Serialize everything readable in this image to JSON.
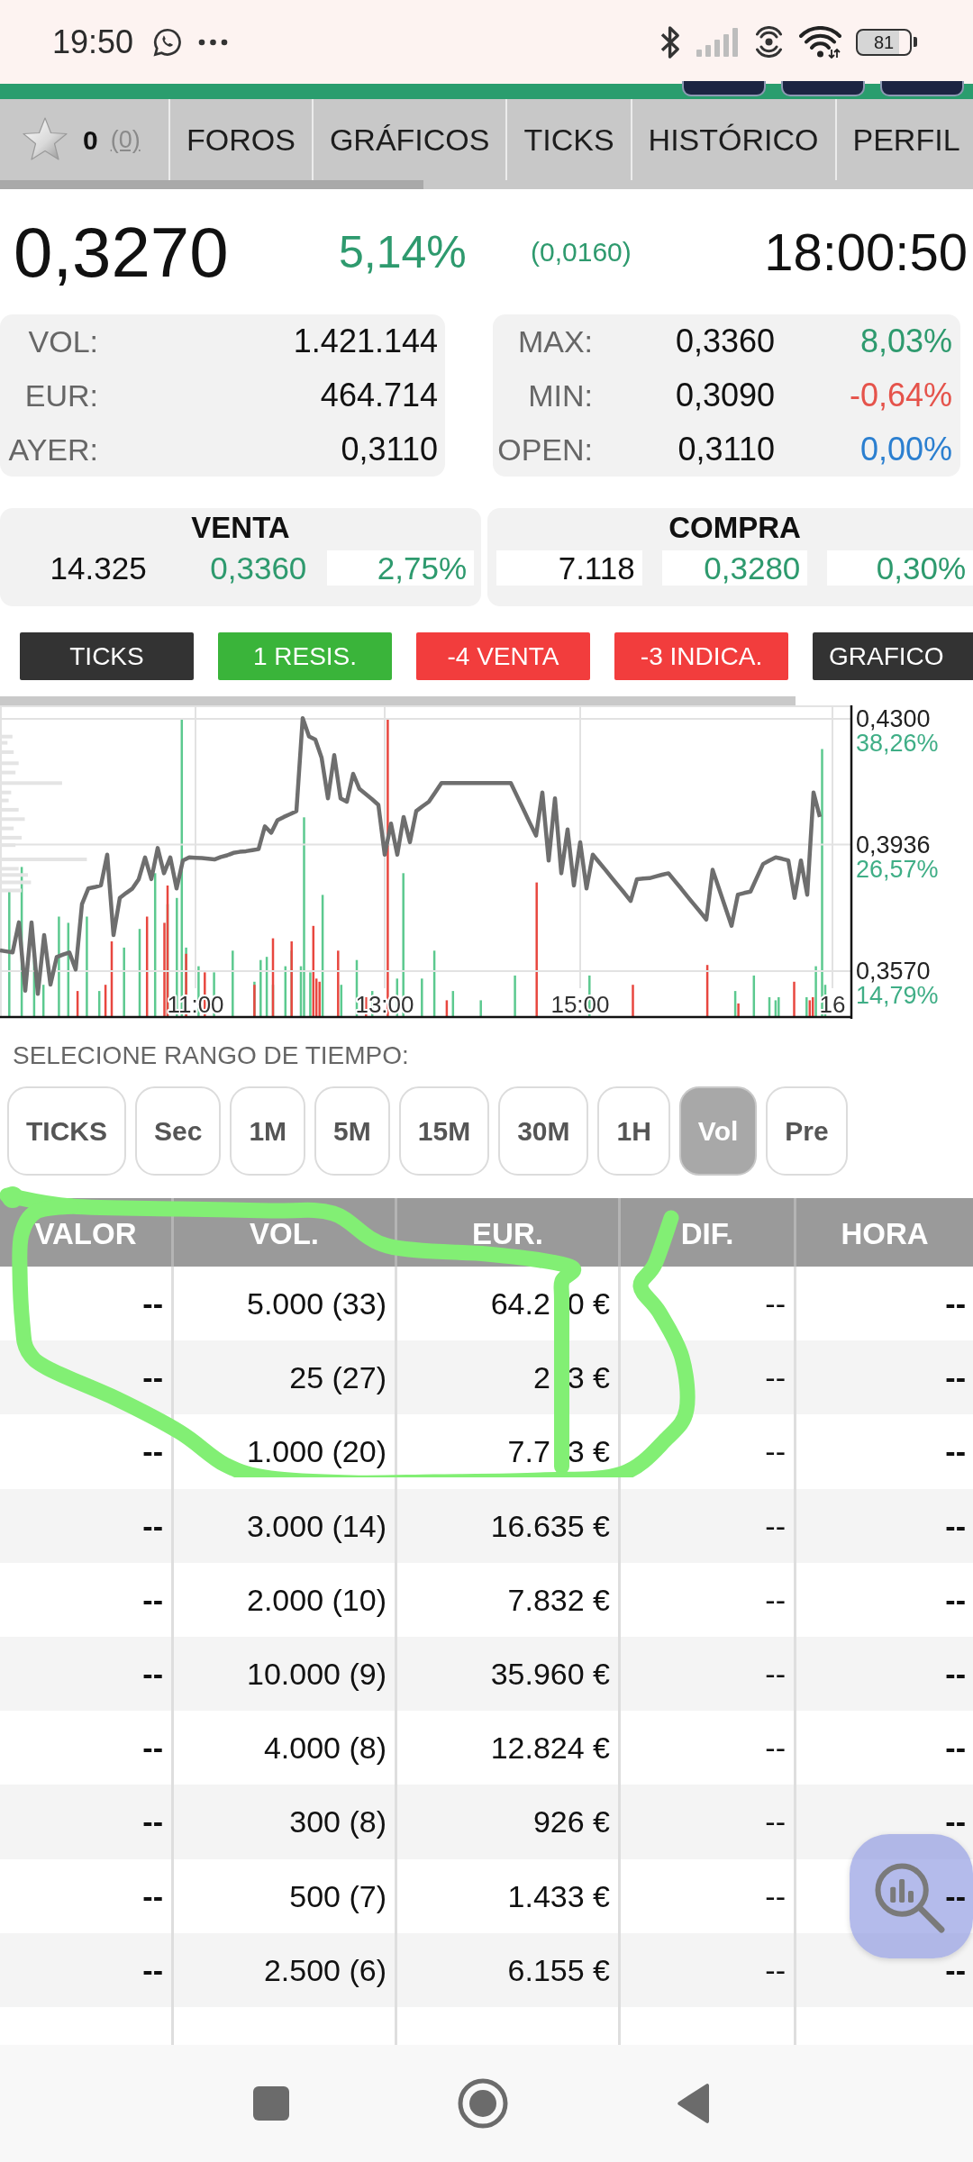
{
  "status_bar": {
    "time": "19:50",
    "battery": "81"
  },
  "tabs": {
    "favorites": {
      "count": "0",
      "link": "(0)"
    },
    "items": [
      {
        "label": "FOROS"
      },
      {
        "label": "GRÁFICOS"
      },
      {
        "label": "TICKS"
      },
      {
        "label": "HISTÓRICO"
      },
      {
        "label": "PERFIL"
      }
    ]
  },
  "quote": {
    "price": "0,3270",
    "change_pct": "5,14%",
    "change_abs": "(0,0160)",
    "color": "#2e9a6e",
    "time": "18:00:50"
  },
  "stats_left": [
    {
      "label": "VOL:",
      "value": "1.421.144"
    },
    {
      "label": "EUR:",
      "value": "464.714"
    },
    {
      "label": "AYER:",
      "value": "0,3110"
    }
  ],
  "stats_right": [
    {
      "label": "MAX:",
      "value": "0,3360",
      "change": "8,03%",
      "color": "#2e9a6e"
    },
    {
      "label": "MIN:",
      "value": "0,3090",
      "change": "-0,64%",
      "color": "#e5534b"
    },
    {
      "label": "OPEN:",
      "value": "0,3110",
      "change": "0,00%",
      "color": "#2b7fd0"
    }
  ],
  "order_book": [
    {
      "title": "VENTA",
      "cells": [
        {
          "text": "14.325",
          "boxed": false
        },
        {
          "text": "0,3360",
          "color": "#2e9a6e",
          "boxed": false
        },
        {
          "text": "2,75%",
          "color": "#2e9a6e",
          "boxed": true
        }
      ]
    },
    {
      "title": "COMPRA",
      "cells": [
        {
          "text": "7.118",
          "boxed": true
        },
        {
          "text": "0,3280",
          "color": "#2e9a6e",
          "boxed": true
        },
        {
          "text": "0,30%",
          "color": "#2e9a6e",
          "boxed": true
        }
      ]
    }
  ],
  "signals": [
    {
      "label": "TICKS",
      "color": "#333333"
    },
    {
      "label": "1 RESIS.",
      "color": "#3ab43a"
    },
    {
      "label": "-4 VENTA",
      "color": "#f23d3d"
    },
    {
      "label": "-3 INDICA.",
      "color": "#f23d3d"
    },
    {
      "label": "GRAFICO",
      "color": "#333333"
    }
  ],
  "chart": {
    "chart_data": {
      "type": "line",
      "grid": true,
      "categories": [
        null,
        null,
        null,
        null,
        null,
        null,
        null,
        null,
        null,
        null,
        null,
        null,
        null,
        null,
        null,
        null,
        null,
        null,
        null,
        null,
        null,
        null,
        null,
        null,
        null,
        null,
        null,
        null,
        null,
        null,
        null,
        "11:00",
        null,
        null,
        null,
        null,
        null,
        null,
        null,
        null,
        null,
        null,
        null,
        null,
        null,
        null,
        null,
        null,
        null,
        null,
        null,
        null,
        null,
        null,
        null,
        null,
        null,
        null,
        null,
        null,
        null,
        "13:00",
        null,
        null,
        null,
        null,
        null,
        null,
        null,
        null,
        null,
        null,
        null,
        null,
        null,
        null,
        null,
        null,
        null,
        null,
        null,
        null,
        null,
        null,
        null,
        null,
        null,
        null,
        null,
        null,
        null,
        null,
        "15:00",
        null,
        null,
        null,
        null,
        null,
        null,
        null,
        null,
        null,
        null,
        null,
        null,
        null,
        null,
        null,
        null,
        null,
        null,
        null,
        null,
        null,
        null,
        null,
        null,
        null,
        null,
        null,
        null,
        null,
        null,
        null,
        null,
        null,
        null,
        null,
        null,
        null,
        null,
        null,
        "16",
        null,
        null,
        null
      ],
      "series": [
        {
          "color": "#6e6e6e",
          "values": [
            0.363,
            0.3627,
            0.3624,
            0.3711,
            0.3513,
            0.3711,
            0.3504,
            0.3674,
            0.3531,
            0.3611,
            0.3618,
            0.3624,
            0.3575,
            0.3764,
            0.3809,
            0.3813,
            0.3818,
            0.3907,
            0.3674,
            0.3782,
            0.3796,
            0.3809,
            0.3836,
            0.3899,
            0.3836,
            0.3926,
            0.3853,
            0.3899,
            0.3809,
            0.389,
            0.3899,
            0.3898,
            0.3897,
            0.3895,
            0.3893,
            0.39,
            0.3905,
            0.3912,
            0.3915,
            0.3917,
            0.392,
            0.3923,
            0.3989,
            0.397,
            0.4007,
            0.4016,
            0.4024,
            0.4033,
            0.4302,
            0.4249,
            0.424,
            0.4187,
            0.407,
            0.4195,
            0.407,
            0.406,
            0.4141,
            0.4097,
            0.4082,
            0.4067,
            0.4051,
            0.3907,
            0.3997,
            0.3907,
            0.4016,
            0.3943,
            0.4033,
            0.4047,
            0.406,
            0.4087,
            0.4114,
            0.4114,
            0.4114,
            0.4114,
            0.4114,
            0.4114,
            0.4114,
            0.4114,
            0.4114,
            0.4114,
            0.4114,
            0.4114,
            0.4076,
            0.4038,
            0.3999,
            0.3962,
            0.4087,
            0.389,
            0.407,
            0.3853,
            0.398,
            0.3818,
            0.3943,
            0.3809,
            0.3907,
            0.3885,
            0.3863,
            0.384,
            0.3818,
            0.3796,
            0.3773,
            0.3836,
            0.3838,
            0.3839,
            0.3844,
            0.3849,
            0.3853,
            0.3831,
            0.3809,
            0.3786,
            0.3764,
            0.3742,
            0.3719,
            0.3863,
            0.3809,
            0.3755,
            0.3701,
            0.3791,
            0.3796,
            0.38,
            0.384,
            0.388,
            0.389,
            0.3899,
            0.3895,
            0.389,
            0.3782,
            0.389,
            0.3791,
            0.4087,
            0.4016,
            null,
            null,
            null,
            null,
            null
          ]
        }
      ],
      "ylim": [
        0.3437,
        0.4339
      ],
      "yticks": [
        {
          "value": 0.43,
          "label": "0,4300"
        },
        {
          "value": 0.3936,
          "label": "0,3936"
        },
        {
          "value": 0.357,
          "label": "0,3570"
        }
      ],
      "annotations": [
        "38,26%",
        "26,57%",
        "14,79%"
      ]
    }
  },
  "range_selector": {
    "title": "SELECIONE RANGO DE TIEMPO:",
    "options": [
      {
        "label": "TICKS",
        "selected": false
      },
      {
        "label": "Sec",
        "selected": false
      },
      {
        "label": "1M",
        "selected": false
      },
      {
        "label": "5M",
        "selected": false
      },
      {
        "label": "15M",
        "selected": false
      },
      {
        "label": "30M",
        "selected": false
      },
      {
        "label": "1H",
        "selected": false
      },
      {
        "label": "Vol",
        "selected": true
      },
      {
        "label": "Pre",
        "selected": false
      }
    ]
  },
  "table": {
    "columns": [
      "VALOR",
      "VOL.",
      "EUR.",
      "DIF.",
      "HORA"
    ],
    "rows": [
      {
        "valor": "--",
        "vol": "5.000 (33)",
        "eur": "64.2 0 €",
        "dif": "--",
        "hora": "--"
      },
      {
        "valor": "--",
        "vol": "25 (27)",
        "eur": "2 3 €",
        "dif": "--",
        "hora": "--"
      },
      {
        "valor": "--",
        "vol": "1.000 (20)",
        "eur": "7.7 3 €",
        "dif": "--",
        "hora": "--"
      },
      {
        "valor": "--",
        "vol": "3.000 (14)",
        "eur": "16.635 €",
        "dif": "--",
        "hora": "--"
      },
      {
        "valor": "--",
        "vol": "2.000 (10)",
        "eur": "7.832 €",
        "dif": "--",
        "hora": "--"
      },
      {
        "valor": "--",
        "vol": "10.000 (9)",
        "eur": "35.960 €",
        "dif": "--",
        "hora": "--"
      },
      {
        "valor": "--",
        "vol": "4.000 (8)",
        "eur": "12.824 €",
        "dif": "--",
        "hora": "--"
      },
      {
        "valor": "--",
        "vol": "300 (8)",
        "eur": "926 €",
        "dif": "--",
        "hora": "--"
      },
      {
        "valor": "--",
        "vol": "500 (7)",
        "eur": "1.433 €",
        "dif": "--",
        "hora": "--"
      },
      {
        "valor": "--",
        "vol": "2.500 (6)",
        "eur": "6.155 €",
        "dif": "--",
        "hora": "--"
      }
    ]
  }
}
